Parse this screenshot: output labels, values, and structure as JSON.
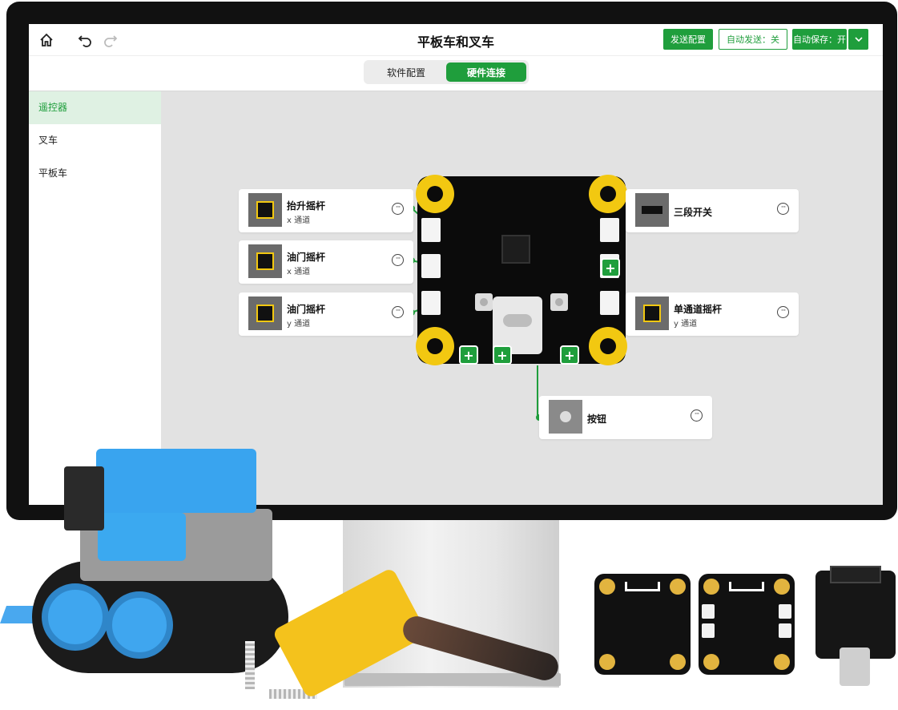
{
  "app": {
    "title": "平板车和叉车",
    "send_config": "发送配置",
    "auto_send": "自动发送：关",
    "auto_save": "自动保存：开"
  },
  "tabs": [
    {
      "label": "软件配置",
      "active": false
    },
    {
      "label": "硬件连接",
      "active": true
    }
  ],
  "sidebar": {
    "items": [
      {
        "label": "遥控器",
        "active": true
      },
      {
        "label": "叉车",
        "active": false
      },
      {
        "label": "平板车",
        "active": false
      }
    ]
  },
  "devices": {
    "lift_stick": {
      "name": "抬升摇杆",
      "channel": "x 通道"
    },
    "throttle_x": {
      "name": "油门摇杆",
      "channel": "x 通道"
    },
    "throttle_y": {
      "name": "油门摇杆",
      "channel": "y 通道"
    },
    "three_switch": {
      "name": "三段开关",
      "channel": ""
    },
    "single_stick": {
      "name": "单通道摇杆",
      "channel": "y 通道"
    },
    "button": {
      "name": "按钮",
      "channel": ""
    }
  },
  "add_label": "+",
  "more_label": "···",
  "colors": {
    "accent": "#1f9e3c",
    "canvas_bg": "#e2e2e2",
    "pad": "#f2c811"
  },
  "icons": [
    "home-icon",
    "undo-icon",
    "redo-icon",
    "chevron-down-icon",
    "more-icon",
    "plus-icon"
  ]
}
